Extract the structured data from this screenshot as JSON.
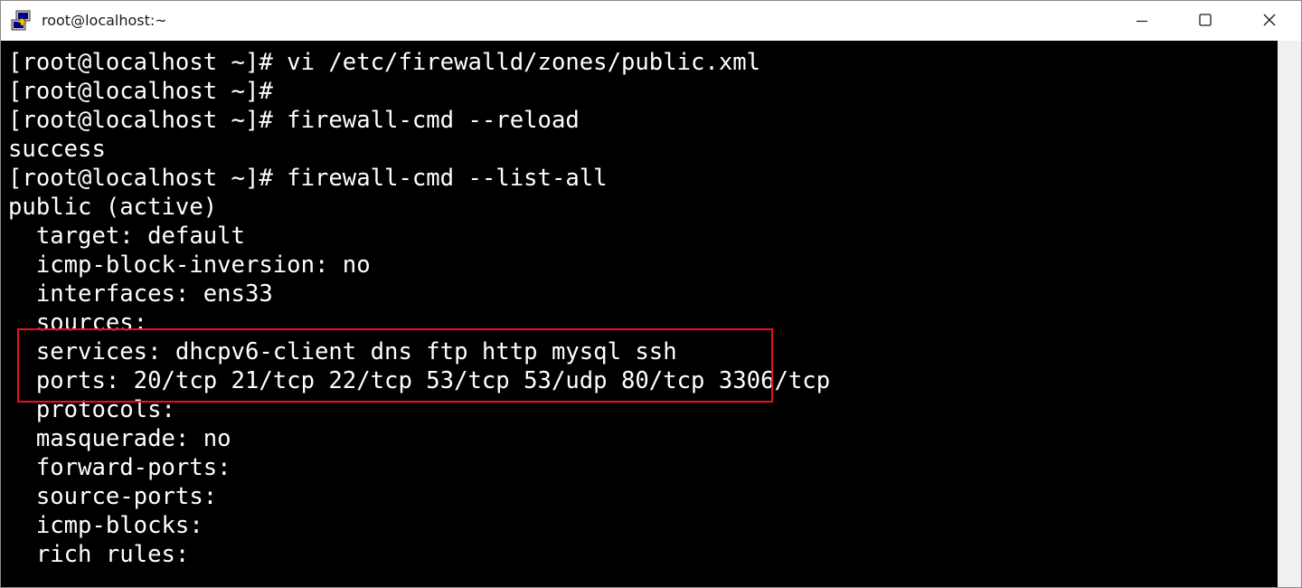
{
  "window": {
    "title": "root@localhost:~",
    "app_icon": "putty-terminal-icon",
    "controls": {
      "minimize_icon": "minimize-icon",
      "maximize_icon": "maximize-icon",
      "close_icon": "close-icon"
    }
  },
  "terminal": {
    "background": "#000000",
    "foreground": "#ffffff",
    "highlight_color": "#e81123",
    "lines": [
      "[root@localhost ~]# vi /etc/firewalld/zones/public.xml",
      "[root@localhost ~]#",
      "[root@localhost ~]# firewall-cmd --reload",
      "success",
      "[root@localhost ~]# firewall-cmd --list-all",
      "public (active)",
      "  target: default",
      "  icmp-block-inversion: no",
      "  interfaces: ens33",
      "  sources:",
      "  services: dhcpv6-client dns ftp http mysql ssh",
      "  ports: 20/tcp 21/tcp 22/tcp 53/tcp 53/udp 80/tcp 3306/tcp",
      "  protocols:",
      "  masquerade: no",
      "  forward-ports:",
      "  source-ports:",
      "  icmp-blocks:",
      "  rich rules:"
    ]
  }
}
